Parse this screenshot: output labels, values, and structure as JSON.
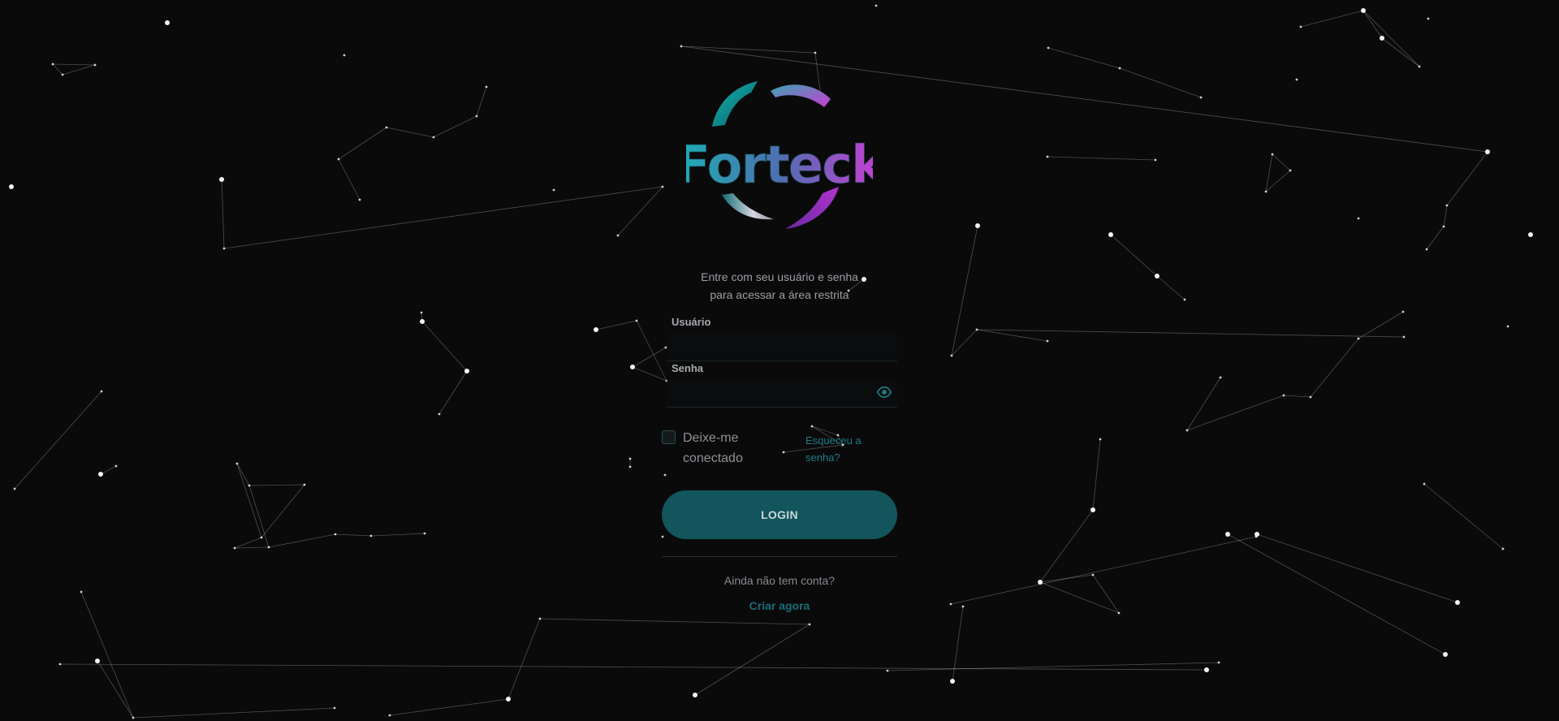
{
  "brand": {
    "name": "Forteck",
    "colors": {
      "teal": "#1bb0b4",
      "purple": "#8f3fd0",
      "magenta": "#d13bd6",
      "background": "#0a0a0b",
      "accent": "#12555c"
    }
  },
  "login": {
    "subtitle_line1": "Entre com seu usuário e senha",
    "subtitle_line2": "para acessar a área restrita",
    "username_label": "Usuário",
    "username_value": "",
    "password_label": "Senha",
    "password_value": "",
    "password_toggle_icon": "eye-icon",
    "remember_label": "Deixe-me conectado",
    "remember_checked": false,
    "forgot_link": "Esqueceu a senha?",
    "submit_label": "LOGIN",
    "no_account_text": "Ainda não tem conta?",
    "create_account_link": "Criar agora"
  },
  "background": {
    "style": "constellation-particles",
    "star_color": "#ffffff",
    "line_color": "#ffffff"
  }
}
